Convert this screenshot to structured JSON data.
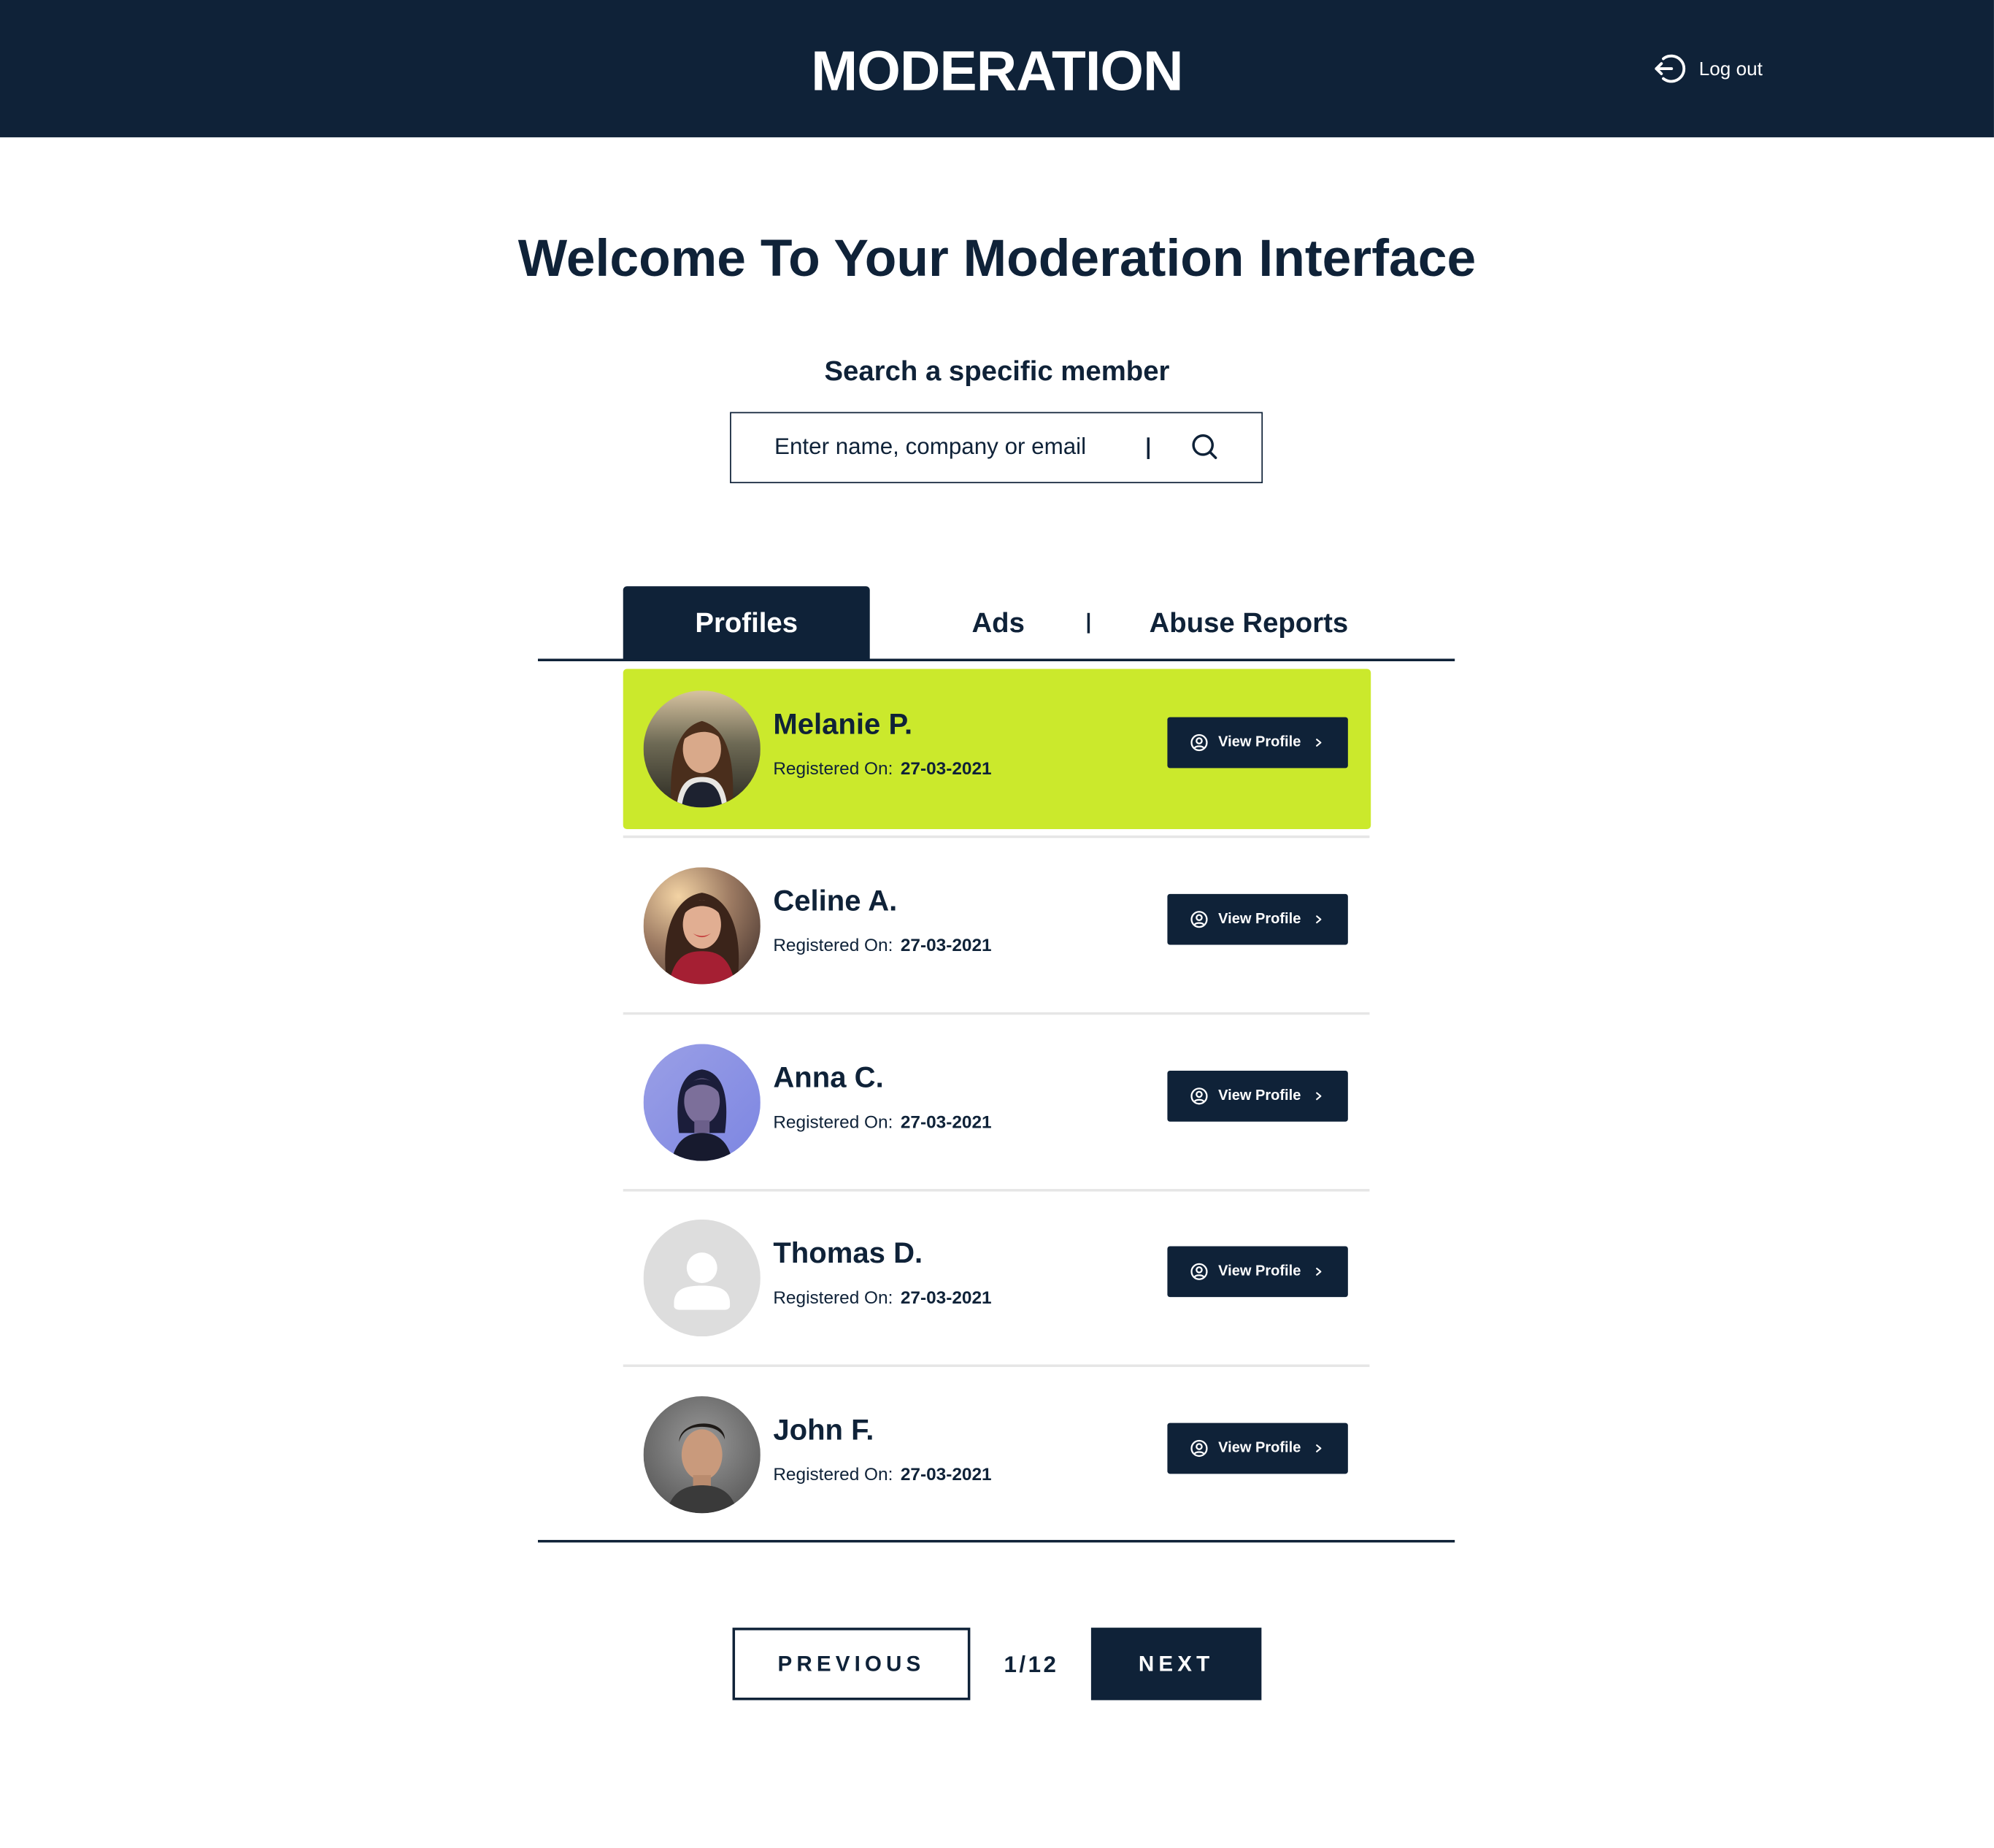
{
  "header": {
    "title": "MODERATION",
    "logout_label": "Log out"
  },
  "main": {
    "welcome_title": "Welcome To Your Moderation Interface",
    "search_label": "Search a specific member",
    "search_placeholder": "Enter name, company or email"
  },
  "tabs": [
    {
      "label": "Profiles",
      "active": true
    },
    {
      "label": "Ads",
      "active": false
    },
    {
      "label": "Abuse Reports",
      "active": false
    }
  ],
  "profiles": [
    {
      "name": "Melanie P.",
      "registered_label": "Registered On:",
      "registered_date": "27-03-2021",
      "button_label": "View Profile",
      "highlighted": true,
      "avatar": "photo-woman-brown-hair"
    },
    {
      "name": "Celine A.",
      "registered_label": "Registered On:",
      "registered_date": "27-03-2021",
      "button_label": "View Profile",
      "highlighted": false,
      "avatar": "photo-woman-red-top"
    },
    {
      "name": "Anna C.",
      "registered_label": "Registered On:",
      "registered_date": "27-03-2021",
      "button_label": "View Profile",
      "highlighted": false,
      "avatar": "photo-woman-blue-light"
    },
    {
      "name": "Thomas D.",
      "registered_label": "Registered On:",
      "registered_date": "27-03-2021",
      "button_label": "View Profile",
      "highlighted": false,
      "avatar": "default-avatar-placeholder"
    },
    {
      "name": "John F.",
      "registered_label": "Registered On:",
      "registered_date": "27-03-2021",
      "button_label": "View Profile",
      "highlighted": false,
      "avatar": "photo-man-grey-bg"
    }
  ],
  "pagination": {
    "previous_label": "PREVIOUS",
    "page_indicator": "1/12",
    "next_label": "NEXT"
  },
  "colors": {
    "navy": "#0f2238",
    "highlight": "#cbe92c",
    "separator": "#e6e6e6",
    "placeholder_avatar": "#dddddd"
  },
  "icons": {
    "logout": "logout-icon",
    "search": "search-icon",
    "view_profile": "user-circle-icon",
    "chevron": "chevron-right-icon"
  }
}
